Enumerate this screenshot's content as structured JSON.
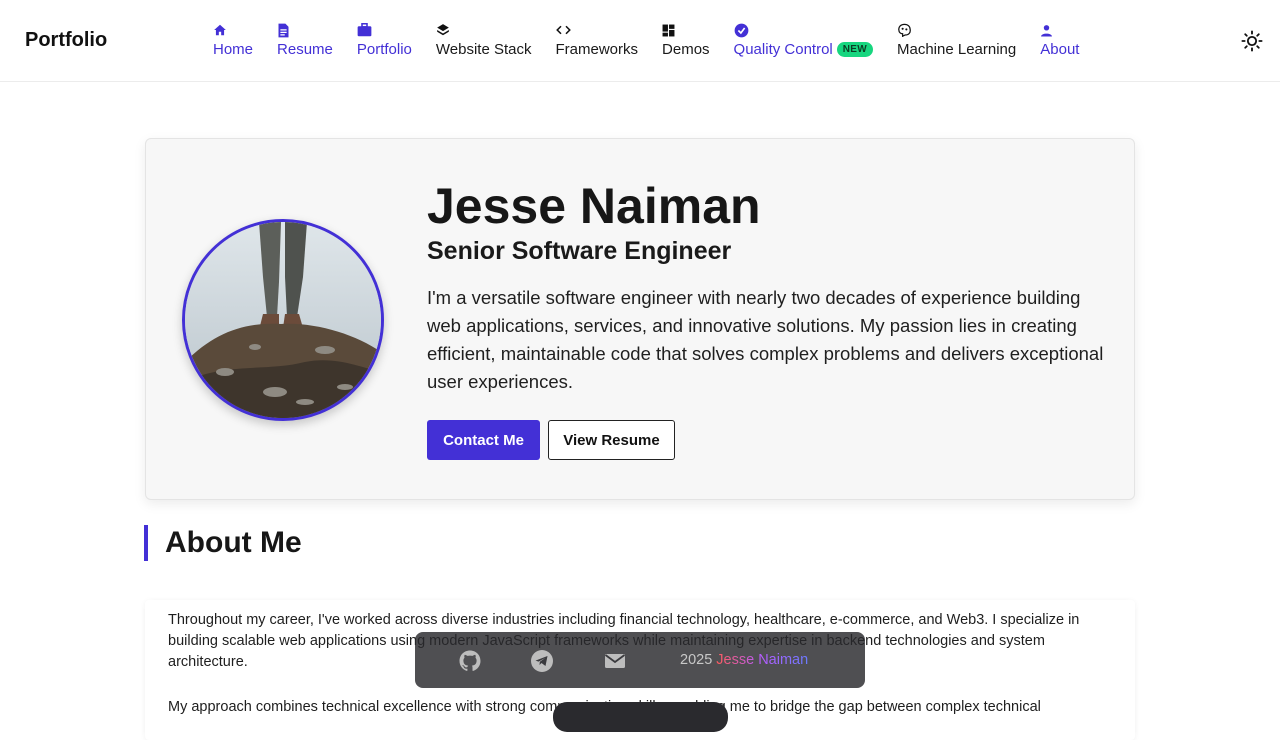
{
  "header": {
    "logo": "Portfolio",
    "nav": [
      {
        "label": "Home",
        "icon": "home-icon",
        "active": true
      },
      {
        "label": "Resume",
        "icon": "document-icon",
        "active": true
      },
      {
        "label": "Portfolio",
        "icon": "briefcase-icon",
        "active": true
      },
      {
        "label": "Website Stack",
        "icon": "layers-icon",
        "active": false
      },
      {
        "label": "Frameworks",
        "icon": "code-icon",
        "active": false
      },
      {
        "label": "Demos",
        "icon": "grid-icon",
        "active": false
      },
      {
        "label": "Quality Control",
        "icon": "verified-badge-icon",
        "active": true,
        "badge": "NEW"
      },
      {
        "label": "Machine Learning",
        "icon": "brain-icon",
        "active": false
      },
      {
        "label": "About",
        "icon": "user-icon",
        "active": true
      }
    ],
    "theme_toggle_icon": "sun-icon"
  },
  "hero": {
    "name": "Jesse Naiman",
    "title": "Senior Software Engineer",
    "bio": "I'm a versatile software engineer with nearly two decades of experience building web applications, services, and innovative solutions. My passion lies in creating efficient, maintainable code that solves complex problems and delivers exceptional user experiences.",
    "contact_button": "Contact Me",
    "resume_button": "View Resume"
  },
  "about": {
    "heading": "About Me",
    "paragraphs": [
      "Throughout my career, I've worked across diverse industries including financial technology, healthcare, e-commerce, and Web3. I specialize in building scalable web applications using modern JavaScript frameworks while maintaining expertise in backend technologies and system architecture.",
      "My approach combines technical excellence with strong communication skills, enabling me to bridge the gap between complex technical"
    ]
  },
  "footer": {
    "year": "2025",
    "name": "Jesse Naiman",
    "icons": [
      "github-icon",
      "telegram-icon",
      "email-icon"
    ]
  },
  "colors": {
    "accent": "#4330d6",
    "badge": "#17d67f"
  }
}
